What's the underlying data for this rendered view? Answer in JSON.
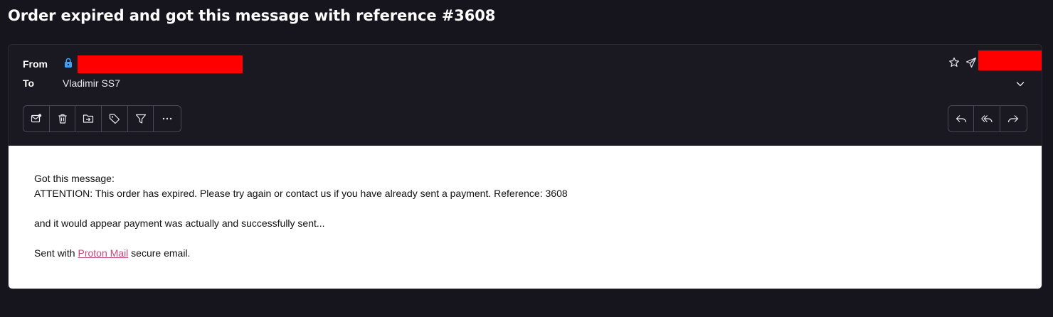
{
  "message": {
    "subject": "Order expired and got this message with reference #3608",
    "from_label": "From",
    "to_label": "To",
    "to_name": "Vladimir SS7",
    "body": {
      "line1": "Got this message:",
      "line2": "ATTENTION: This order has expired. Please try again or contact us if you have already sent a payment. Reference: 3608",
      "line3": "and it would appear payment was actually and successfully sent...",
      "signature_prefix": "Sent with ",
      "signature_link": "Proton Mail",
      "signature_suffix": " secure email."
    }
  },
  "colors": {
    "background": "#16141c",
    "card": "#1a1821",
    "redaction": "#ff0000",
    "link": "#c2497e",
    "lock": "#3aa3ff"
  },
  "icons": {
    "toolbar_left": [
      "mark-unread-icon",
      "trash-icon",
      "move-to-folder-icon",
      "label-tag-icon",
      "filter-icon",
      "more-icon"
    ],
    "toolbar_right": [
      "reply-icon",
      "reply-all-icon",
      "forward-icon"
    ],
    "header": [
      "lock-icon",
      "star-icon",
      "send-icon",
      "chevron-down-icon"
    ]
  }
}
